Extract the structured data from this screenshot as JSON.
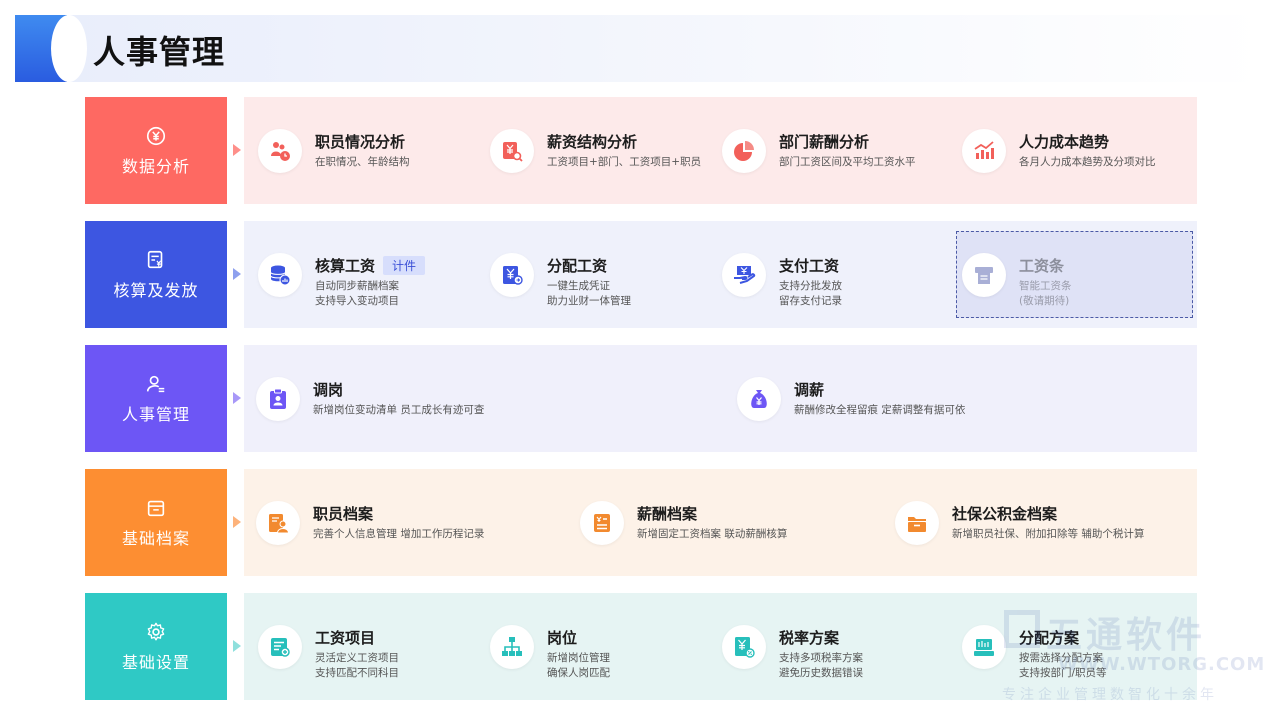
{
  "page": {
    "title": "人事管理"
  },
  "colors": {
    "analysis": "#fe6962",
    "payroll": "#3d56e1",
    "personnel": "#6d56f5",
    "archive": "#fd8e32",
    "settings": "#2fc9c5"
  },
  "rows": [
    {
      "category": {
        "label": "数据分析",
        "icon": "yuan-chart-icon"
      },
      "items": [
        {
          "name": "职员情况分析",
          "desc": [
            "在职情况、年龄结构"
          ],
          "icon": "people-clock-icon"
        },
        {
          "name": "薪资结构分析",
          "desc": [
            "工资项目+部门、工资项目+职员"
          ],
          "icon": "yuan-search-icon"
        },
        {
          "name": "部门薪酬分析",
          "desc": [
            "部门工资区间及平均工资水平"
          ],
          "icon": "pie-chart-icon"
        },
        {
          "name": "人力成本趋势",
          "desc": [
            "各月人力成本趋势及分项对比"
          ],
          "icon": "bar-chart-icon"
        }
      ]
    },
    {
      "category": {
        "label": "核算及发放",
        "icon": "document-yuan-icon"
      },
      "items": [
        {
          "name": "核算工资",
          "badge": "计件",
          "desc": [
            "自动同步薪酬档案",
            "支持导入变动项目"
          ],
          "icon": "database-chart-icon"
        },
        {
          "name": "分配工资",
          "desc": [
            "一键生成凭证",
            "助力业财一体管理"
          ],
          "icon": "yuan-allocate-icon"
        },
        {
          "name": "支付工资",
          "desc": [
            "支持分批发放",
            "留存支付记录"
          ],
          "icon": "hand-money-icon"
        },
        {
          "name": "工资条",
          "desc": [
            "智能工资条",
            "(敬请期待)"
          ],
          "icon": "payslip-printer-icon"
        }
      ]
    },
    {
      "category": {
        "label": "人事管理",
        "icon": "user-list-icon"
      },
      "items": [
        {
          "name": "调岗",
          "desc": [
            "新增岗位变动清单 员工成长有迹可查"
          ],
          "icon": "clipboard-user-icon"
        },
        {
          "name": "调薪",
          "desc": [
            "薪酬修改全程留痕 定薪调整有据可依"
          ],
          "icon": "money-bag-icon"
        }
      ]
    },
    {
      "category": {
        "label": "基础档案",
        "icon": "archive-box-icon"
      },
      "items": [
        {
          "name": "职员档案",
          "desc": [
            "完善个人信息管理 增加工作历程记录"
          ],
          "icon": "user-card-icon"
        },
        {
          "name": "薪酬档案",
          "desc": [
            "新增固定工资档案 联动薪酬核算"
          ],
          "icon": "yuan-doc-icon"
        },
        {
          "name": "社保公积金档案",
          "desc": [
            "新增职员社保、附加扣除等 辅助个税计算"
          ],
          "icon": "folder-box-icon"
        }
      ]
    },
    {
      "category": {
        "label": "基础设置",
        "icon": "gear-icon"
      },
      "items": [
        {
          "name": "工资项目",
          "desc": [
            "灵活定义工资项目",
            "支持匹配不同科目"
          ],
          "icon": "list-add-icon"
        },
        {
          "name": "岗位",
          "desc": [
            "新增岗位管理",
            "确保人岗匹配"
          ],
          "icon": "org-chart-icon"
        },
        {
          "name": "税率方案",
          "desc": [
            "支持多项税率方案",
            "避免历史数据错误"
          ],
          "icon": "tax-percent-icon"
        },
        {
          "name": "分配方案",
          "desc": [
            "按需选择分配方案",
            "支持按部门/职员等"
          ],
          "icon": "register-icon"
        }
      ]
    }
  ],
  "watermark": {
    "brand": "五通软件",
    "url": "WWW.WTORG.COM",
    "slogan": "专注企业管理数智化十余年"
  }
}
